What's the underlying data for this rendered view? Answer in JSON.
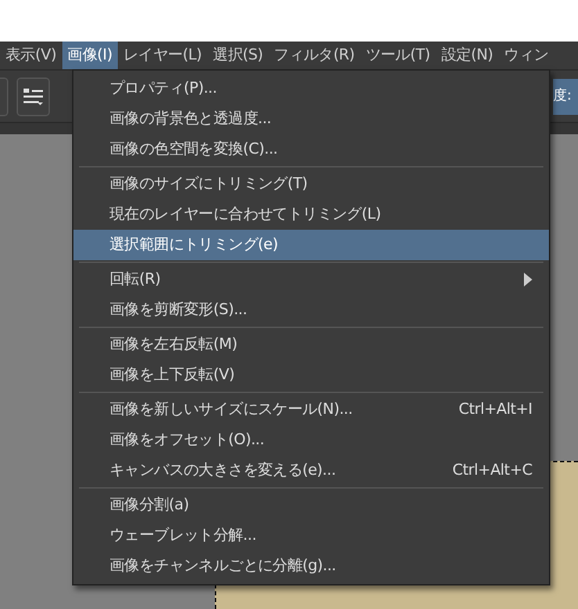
{
  "menubar": [
    {
      "label": "表示(V)",
      "selected": false
    },
    {
      "label": "画像(I)",
      "selected": true
    },
    {
      "label": "レイヤー(L)",
      "selected": false
    },
    {
      "label": "選択(S)",
      "selected": false
    },
    {
      "label": "フィルタ(R)",
      "selected": false
    },
    {
      "label": "ツール(T)",
      "selected": false
    },
    {
      "label": "設定(N)",
      "selected": false
    },
    {
      "label": "ウィン",
      "selected": false
    }
  ],
  "toolbar": {
    "field_label": "度:"
  },
  "menu": {
    "groups": [
      [
        {
          "label": "プロパティ(P)...",
          "selected": false
        },
        {
          "label": "画像の背景色と透過度...",
          "selected": false
        },
        {
          "label": "画像の色空間を変換(C)...",
          "selected": false
        }
      ],
      [
        {
          "label": "画像のサイズにトリミング(T)",
          "selected": false
        },
        {
          "label": "現在のレイヤーに合わせてトリミング(L)",
          "selected": false
        },
        {
          "label": "選択範囲にトリミング(e)",
          "selected": true
        }
      ],
      [
        {
          "label": "回転(R)",
          "selected": false,
          "submenu": true
        },
        {
          "label": "画像を剪断変形(S)...",
          "selected": false
        }
      ],
      [
        {
          "label": "画像を左右反転(M)",
          "selected": false
        },
        {
          "label": "画像を上下反転(V)",
          "selected": false
        }
      ],
      [
        {
          "label": "画像を新しいサイズにスケール(N)...",
          "selected": false,
          "shortcut": "Ctrl+Alt+I"
        },
        {
          "label": "画像をオフセット(O)...",
          "selected": false
        },
        {
          "label": "キャンバスの大きさを変える(e)...",
          "selected": false,
          "shortcut": "Ctrl+Alt+C"
        }
      ],
      [
        {
          "label": "画像分割(a)",
          "selected": false
        },
        {
          "label": "ウェーブレット分解...",
          "selected": false
        },
        {
          "label": "画像をチャンネルごとに分離(g)...",
          "selected": false
        }
      ]
    ]
  }
}
